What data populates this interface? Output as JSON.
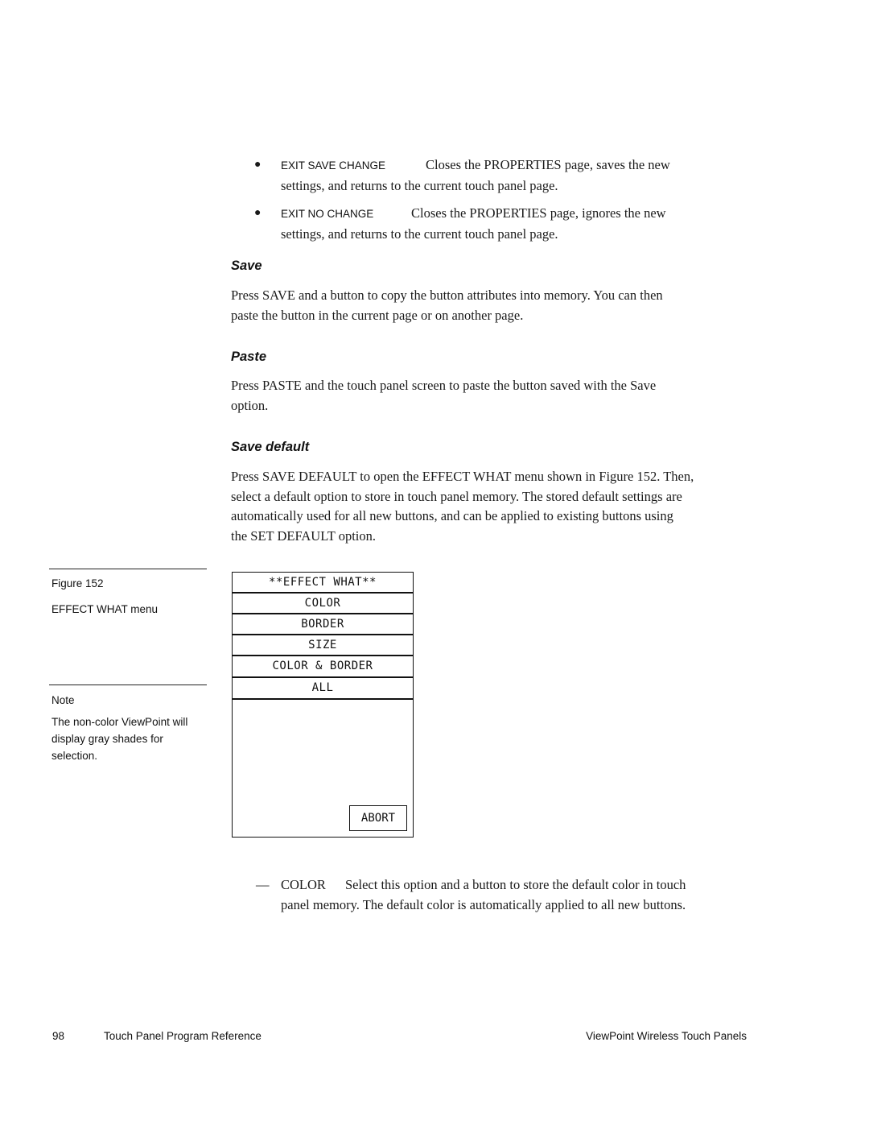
{
  "bullets": [
    {
      "term": "EXIT SAVE CHANGE",
      "text_line1": "Closes the PROPERTIES page, saves the new",
      "text_line2": "settings, and returns to the current touch panel page."
    },
    {
      "term": "EXIT NO CHANGE",
      "text_line1": "Closes the PROPERTIES page, ignores the new",
      "text_line2": "settings, and returns to the current touch panel page."
    }
  ],
  "sections": [
    {
      "heading": "Save",
      "lines": [
        "Press SAVE and a button to copy the button attributes into memory. You can then",
        "paste the button in the current page or on another page."
      ]
    },
    {
      "heading": "Paste",
      "lines": [
        "Press PASTE and the touch panel screen to paste the button saved with the Save",
        "option."
      ]
    },
    {
      "heading": "Save default",
      "lines": [
        "Press SAVE DEFAULT to open the EFFECT WHAT menu shown in Figure 152. Then,",
        "select a default option to store in touch panel memory. The stored default settings are",
        "automatically used for all new buttons, and can be applied to existing buttons using",
        "the SET DEFAULT option."
      ]
    }
  ],
  "sidebar": {
    "figure_label": "Figure 152",
    "figure_caption": "EFFECT WHAT menu",
    "note_label": "Note",
    "note_lines": [
      "The non-color ViewPoint will",
      "display gray shades for",
      "selection."
    ]
  },
  "menu": {
    "title": "**EFFECT WHAT**",
    "items": [
      "COLOR",
      "BORDER",
      "SIZE",
      "COLOR & BORDER",
      "ALL"
    ],
    "abort_label": "ABORT"
  },
  "option": {
    "dash": "—",
    "term": "COLOR",
    "text_line1": "Select this option and a button to store the default color in touch",
    "text_line2": "panel memory. The default color is automatically applied to all new buttons."
  },
  "footer": {
    "page_number": "98",
    "left_title": "Touch Panel Program Reference",
    "right_title": "ViewPoint Wireless Touch Panels"
  }
}
